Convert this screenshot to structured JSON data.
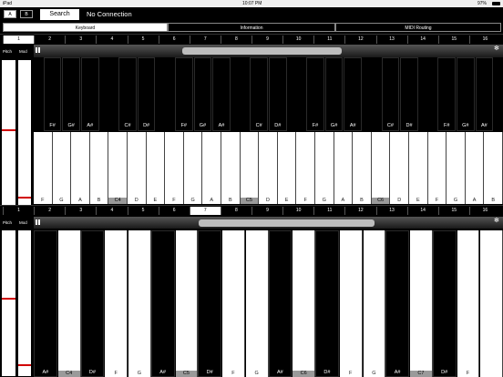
{
  "status": {
    "device": "iPad",
    "time": "10:07 PM",
    "battery": "97%"
  },
  "toolbar": {
    "a_label": "A",
    "b_label": "B",
    "search_label": "Search",
    "connection": "No Connection"
  },
  "tabs": [
    {
      "label": "Keyboard",
      "selected": true
    },
    {
      "label": "Information",
      "selected": false
    },
    {
      "label": "MIDI Routing",
      "selected": false
    }
  ],
  "channels": [
    "1",
    "2",
    "3",
    "4",
    "5",
    "6",
    "7",
    "8",
    "9",
    "10",
    "11",
    "12",
    "13",
    "14",
    "15",
    "16"
  ],
  "panel1": {
    "pitch_label": "Pitch",
    "mod_label": "Mod",
    "selected_channel": 1
  },
  "panel2": {
    "pitch_label": "Pitch",
    "mod_label": "Mod",
    "selected_channel": 7
  },
  "keyboard1": {
    "white_labels": [
      "F",
      "G",
      "A",
      "B",
      "C4",
      "D",
      "E",
      "F",
      "G",
      "A",
      "B",
      "C5",
      "D",
      "E",
      "F",
      "G",
      "A",
      "B",
      "C6",
      "D",
      "E",
      "F",
      "G",
      "A",
      "B"
    ],
    "black_labels": [
      "F#",
      "G#",
      "A#",
      "C#",
      "D#",
      "F#",
      "G#",
      "A#",
      "C#",
      "D#",
      "F#",
      "G#",
      "A#",
      "C#",
      "D#",
      "F#",
      "G#",
      "A#"
    ]
  },
  "keyboard2": {
    "labels": [
      "A#",
      "C4",
      "D#",
      "F",
      "G",
      "A#",
      "C5",
      "D#",
      "F",
      "G",
      "A#",
      "C6",
      "D#",
      "F",
      "G",
      "A#",
      "C7",
      "D#",
      "F"
    ]
  }
}
